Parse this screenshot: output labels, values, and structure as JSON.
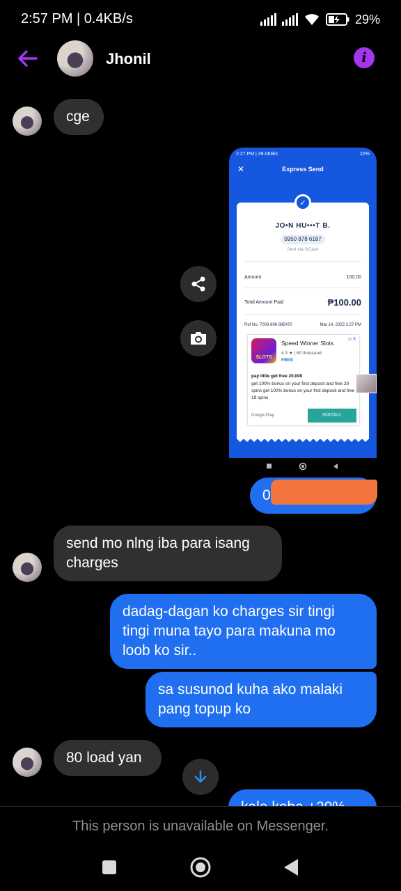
{
  "status_bar": {
    "time_speed": "2:57 PM | 0.4KB/s",
    "battery": "29%",
    "icons": [
      "signal-icon",
      "signal-icon",
      "wifi-icon",
      "battery-charging-icon"
    ]
  },
  "header": {
    "contact_name": "Jhonil",
    "back_icon": "back-arrow-icon",
    "info_icon": "info-icon",
    "accent_color": "#a436f0"
  },
  "messages": [
    {
      "from": "them",
      "text": "cge"
    },
    {
      "from": "me",
      "type": "image",
      "caption": "shared-screenshot"
    },
    {
      "from": "me",
      "text": "0",
      "redacted": true
    },
    {
      "from": "them",
      "text": "send mo nlng iba para isang charges"
    },
    {
      "from": "me",
      "text": "dadag-dagan ko charges sir tingi tingi muna tayo para makuna mo loob ko sir.."
    },
    {
      "from": "me",
      "text": "sa susunod kuha ako malaki pang topup ko"
    },
    {
      "from": "them",
      "text": "80 load yan"
    },
    {
      "from": "me",
      "text": "kala koba +20% "
    }
  ],
  "actions": {
    "share_icon": "share-icon",
    "camera_icon": "camera-icon",
    "scroll_down_icon": "arrow-down-icon"
  },
  "screenshot": {
    "status_left": "2:27 PM | 49.0KB/s",
    "status_right": "22%",
    "title": "Express Send",
    "recipient_name": "JO•N HU•••T B.",
    "recipient_phone": "0950 878 6187",
    "sent_via": "Sent via GCash",
    "amount_label": "Amount",
    "amount_value": "100.00",
    "total_label": "Total Amount Paid",
    "total_value": "₱100.00",
    "ref_label": "Ref No. 7008 696 895470",
    "ref_date": "Mar 14, 2023 2:27 PM",
    "ad": {
      "app_name": "Speed Winner Slots",
      "rating": "4.3 ★ | 60 thousand",
      "price": "FREE",
      "icon_text": "SLOTS",
      "headline": "pay little get free 20,000",
      "body": "get 100% bonus on your first deposit and free 20 spins get 100% bonus on your first deposit and free 19 spins",
      "store": "Google Play",
      "cta": "INSTALL"
    }
  },
  "footer": {
    "unavailable_text": "This person is unavailable on Messenger."
  },
  "colors": {
    "outgoing_bubble": "#1f6ff0",
    "incoming_bubble": "#303030",
    "background": "#000000"
  }
}
